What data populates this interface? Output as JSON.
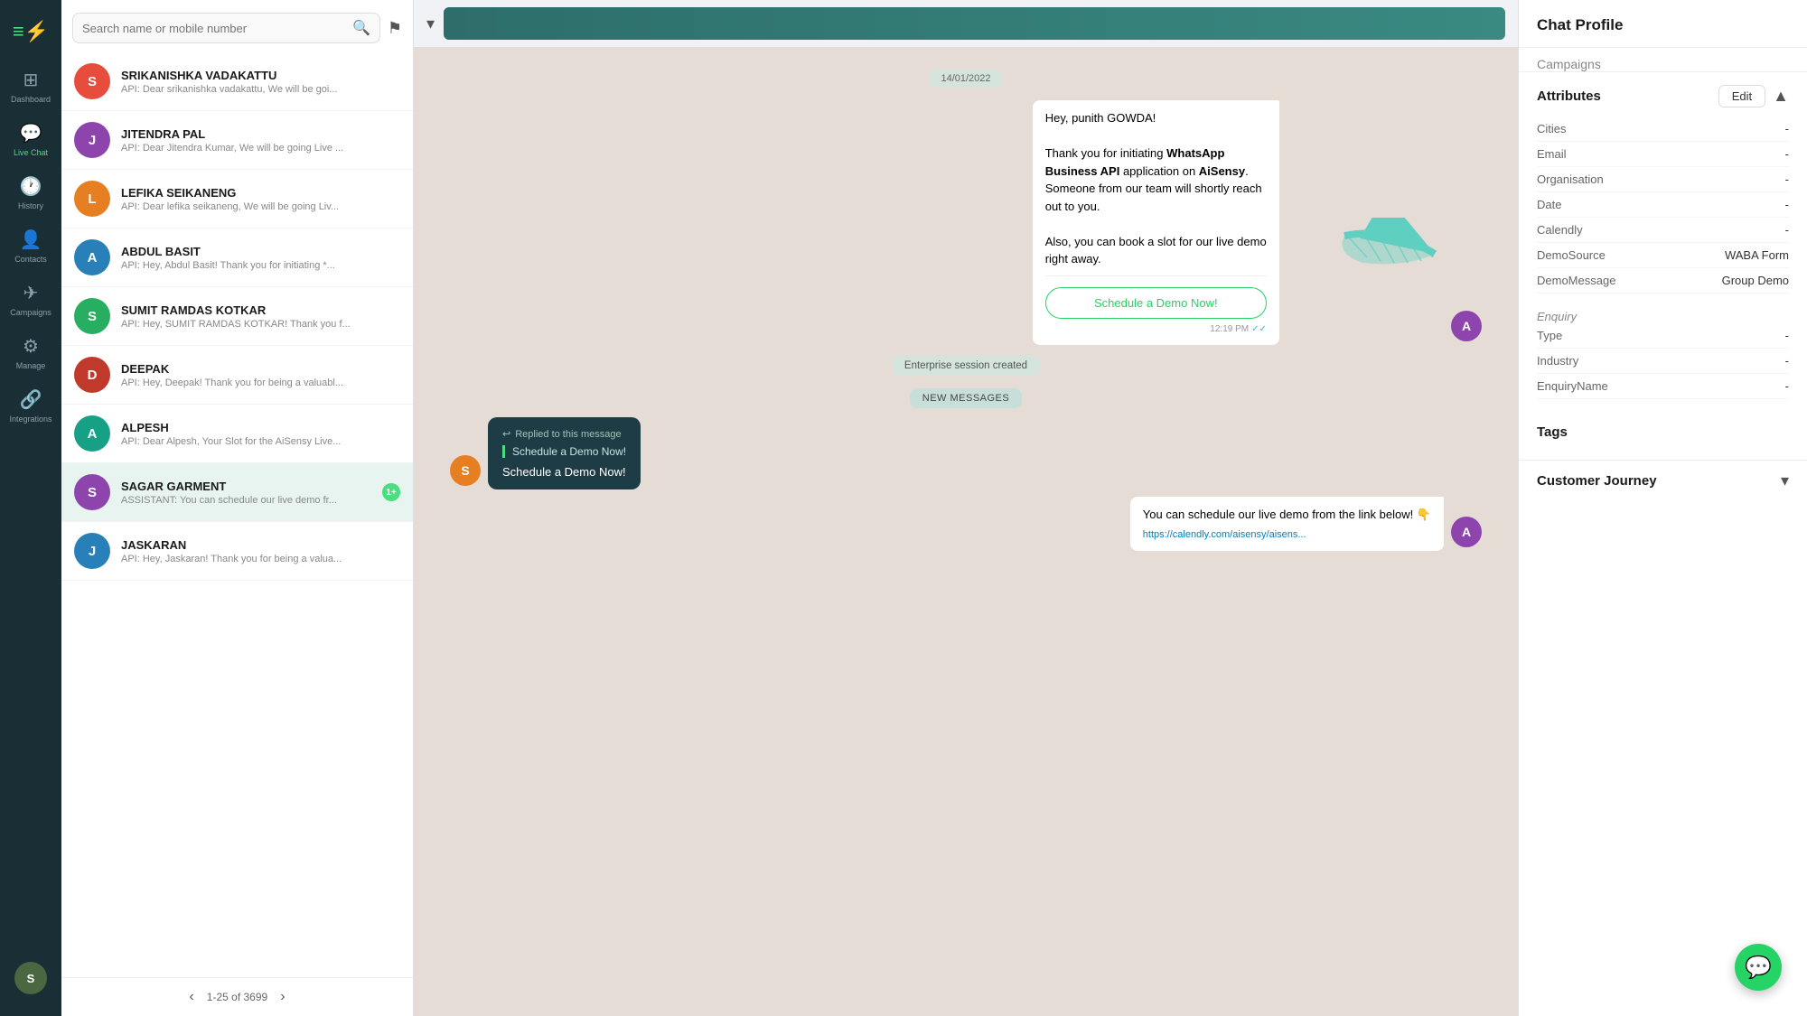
{
  "nav": {
    "logo_text": "≡⚡",
    "items": [
      {
        "id": "dashboard",
        "icon": "⊞",
        "label": "Dashboard",
        "active": false
      },
      {
        "id": "livechat",
        "icon": "💬",
        "label": "Live Chat",
        "active": true
      },
      {
        "id": "history",
        "icon": "🕐",
        "label": "History",
        "active": false
      },
      {
        "id": "contacts",
        "icon": "👤",
        "label": "Contacts",
        "active": false
      },
      {
        "id": "campaigns",
        "icon": "✈",
        "label": "Campaigns",
        "active": false
      },
      {
        "id": "manage",
        "icon": "⚙",
        "label": "Manage",
        "active": false
      },
      {
        "id": "integrations",
        "icon": "🔗",
        "label": "Integrations",
        "active": false
      }
    ],
    "user_initial": "S"
  },
  "search": {
    "placeholder": "Search name or mobile number"
  },
  "contacts": [
    {
      "id": 1,
      "initial": "S",
      "color": "#e74c3c",
      "name": "SRIKANISHKA VADAKATTU",
      "preview": "API: Dear srikanishka vadakattu, We will be goi...",
      "badge": null
    },
    {
      "id": 2,
      "initial": "J",
      "color": "#8e44ad",
      "name": "JITENDRA PAL",
      "preview": "API: Dear Jitendra Kumar, We will be going Live ...",
      "badge": null
    },
    {
      "id": 3,
      "initial": "L",
      "color": "#e67e22",
      "name": "LEFIKA SEIKANENG",
      "preview": "API: Dear lefika seikaneng, We will be going Liv...",
      "badge": null
    },
    {
      "id": 4,
      "initial": "A",
      "color": "#2980b9",
      "name": "ABDUL BASIT",
      "preview": "API: Hey, Abdul Basit! Thank you for initiating *...",
      "badge": null
    },
    {
      "id": 5,
      "initial": "S",
      "color": "#27ae60",
      "name": "SUMIT RAMDAS KOTKAR",
      "preview": "API: Hey, SUMIT RAMDAS KOTKAR! Thank you f...",
      "badge": null
    },
    {
      "id": 6,
      "initial": "D",
      "color": "#c0392b",
      "name": "DEEPAK",
      "preview": "API: Hey, Deepak! Thank you for being a valuabl...",
      "badge": null
    },
    {
      "id": 7,
      "initial": "A",
      "color": "#16a085",
      "name": "ALPESH",
      "preview": "API: Dear Alpesh, Your Slot for the AiSensy Live...",
      "badge": null
    },
    {
      "id": 8,
      "initial": "S",
      "color": "#8e44ad",
      "name": "SAGAR GARMENT",
      "preview": "ASSISTANT: You can schedule our live demo fr...",
      "badge": "1+"
    },
    {
      "id": 9,
      "initial": "J",
      "color": "#2980b9",
      "name": "JASKARAN",
      "preview": "API: Hey, Jaskaran! Thank you for being a valua...",
      "badge": null
    }
  ],
  "pagination": {
    "label": "1-25 of 3699"
  },
  "chat": {
    "date_divider": "14/01/2022",
    "messages": [
      {
        "type": "incoming",
        "avatar_color": "#8e44ad",
        "avatar_initial": "A",
        "text_parts": [
          {
            "text": "Hey, punith GOWDA!",
            "bold": false
          },
          {
            "text": "\n\nThank you for initiating ",
            "bold": false
          },
          {
            "text": "WhatsApp Business API",
            "bold": true
          },
          {
            "text": " application on ",
            "bold": false
          },
          {
            "text": "AiSensy",
            "bold": true
          },
          {
            "text": ".\nSomeone from our team will shortly reach out to you.\n\nAlso, you can book a slot for our live demo right away.",
            "bold": false
          }
        ],
        "schedule_btn": "Schedule a Demo Now!",
        "time": "12:19 PM",
        "has_check": true
      }
    ],
    "system_msg": "Enterprise session created",
    "new_messages_bar": "NEW MESSAGES",
    "reply_bubble": {
      "header": "Replied to this message",
      "reply_text": "Schedule a Demo Now!",
      "action": "Schedule a Demo Now!"
    },
    "second_incoming_avatar": "A",
    "second_incoming_color": "#8e44ad",
    "second_msg_text": "You can schedule our live demo from the link below! 👇",
    "second_msg_url": "https://calendly.com/aisensy/aisens..."
  },
  "profile": {
    "title": "Chat Profile",
    "campaigns_label": "Campaigns",
    "attributes_title": "Attributes",
    "edit_label": "Edit",
    "attributes": [
      {
        "label": "Cities",
        "value": "-"
      },
      {
        "label": "Email",
        "value": "-"
      },
      {
        "label": "Organisation",
        "value": "-"
      },
      {
        "label": "Date",
        "value": "-"
      },
      {
        "label": "Calendly",
        "value": "-"
      },
      {
        "label": "DemoSource",
        "value": "WABA Form"
      },
      {
        "label": "DemoMessage",
        "value": "Group Demo"
      }
    ],
    "enquiry_title": "Enquiry",
    "enquiry_attrs": [
      {
        "label": "Type",
        "value": "-"
      },
      {
        "label": "Industry",
        "value": "-"
      },
      {
        "label": "EnquiryName",
        "value": "-"
      }
    ],
    "tags_title": "Tags",
    "customer_journey_label": "Customer Journey"
  }
}
